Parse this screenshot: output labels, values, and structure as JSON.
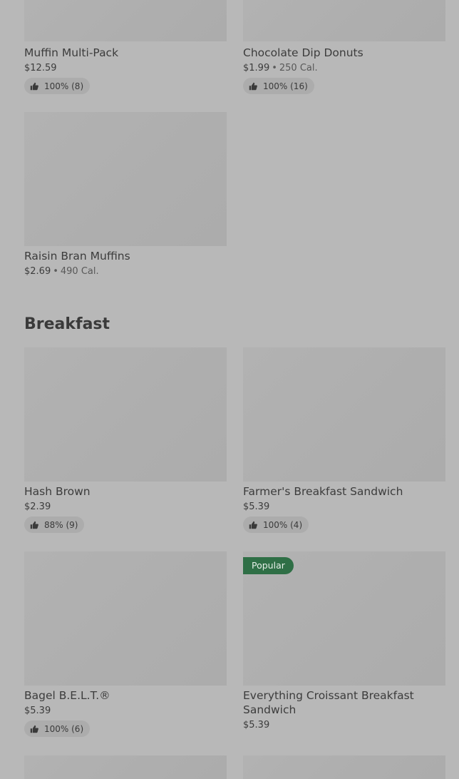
{
  "items": [
    {
      "name": "Muffin Multi-Pack",
      "price": "$12.59",
      "calories": "",
      "rating": "100% (8)"
    },
    {
      "name": "Chocolate Dip Donuts",
      "price": "$1.99",
      "calories": "250 Cal.",
      "rating": "100% (16)"
    },
    {
      "name": "Raisin Bran Muffins",
      "price": "$2.69",
      "calories": "490 Cal.",
      "rating": ""
    }
  ],
  "breakfast": {
    "title": "Breakfast",
    "items": [
      {
        "name": "Hash Brown",
        "price": "$2.39",
        "rating": "88% (9)"
      },
      {
        "name": "Farmer's Breakfast Sandwich",
        "price": "$5.39",
        "rating": "100% (4)"
      },
      {
        "name": "Bagel B.E.L.T.®",
        "price": "$5.39",
        "rating": "100% (6)"
      },
      {
        "name": "Everything Croissant Breakfast Sandwich",
        "price": "$5.39",
        "rating": "",
        "badge": "Popular"
      }
    ]
  },
  "icons": {
    "rating": "thumbs-up-icon"
  },
  "colors": {
    "background": "#b8b8b8",
    "badge": "#2f6f46",
    "text": "#3a3a3a"
  }
}
